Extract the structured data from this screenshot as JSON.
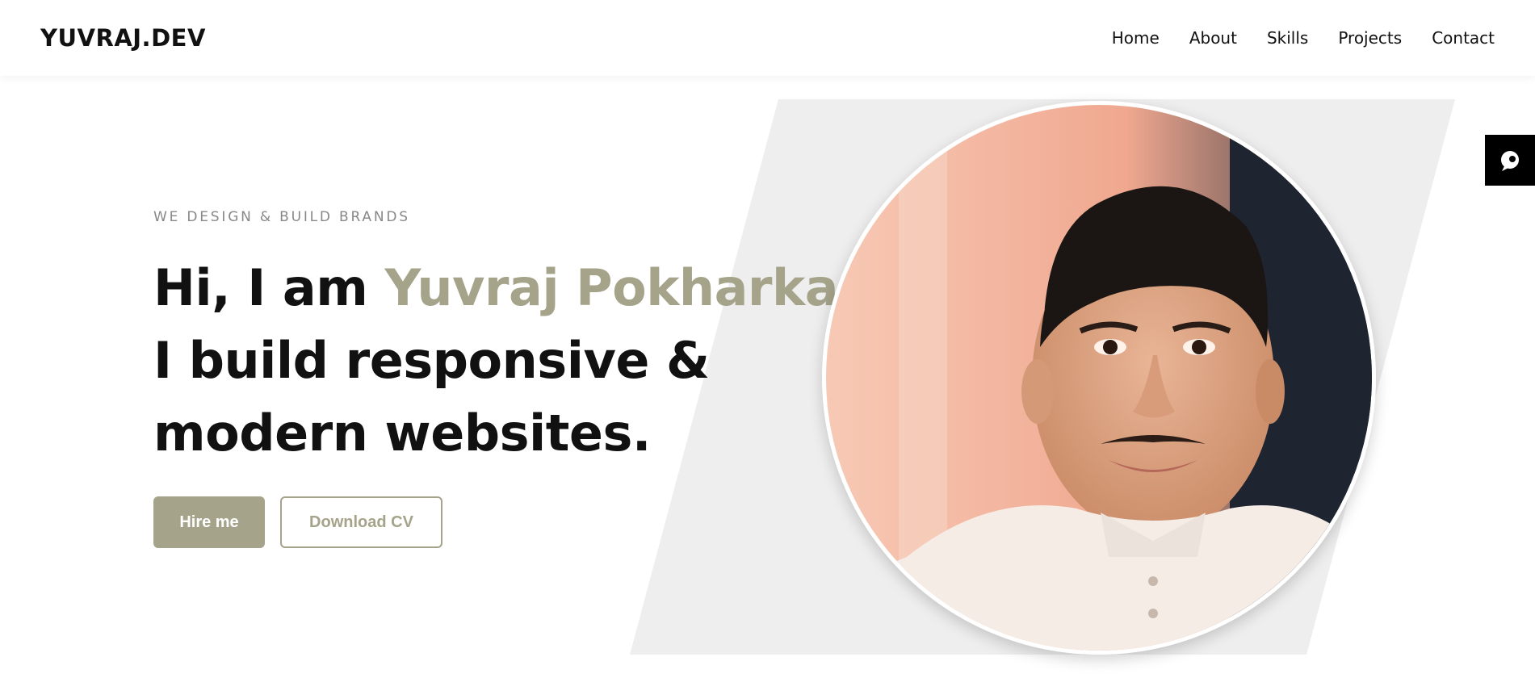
{
  "header": {
    "logo": "YUVRAJ.DEV",
    "nav": [
      "Home",
      "About",
      "Skills",
      "Projects",
      "Contact"
    ]
  },
  "hero": {
    "eyebrow": "WE DESIGN & BUILD BRANDS",
    "greeting": "Hi, I am ",
    "name": "Yuvraj Pokharkar",
    "line2": "I build responsive &",
    "line3": "modern websites.",
    "primary_button": "Hire me",
    "secondary_button": "Download CV"
  },
  "icons": {
    "chat": "chat-bubble-icon",
    "avatar": "profile-photo"
  },
  "colors": {
    "accent": "#a5a38a",
    "text": "#111111",
    "muted": "#888888",
    "shape": "#eeeeee",
    "chat_bg": "#000000"
  }
}
